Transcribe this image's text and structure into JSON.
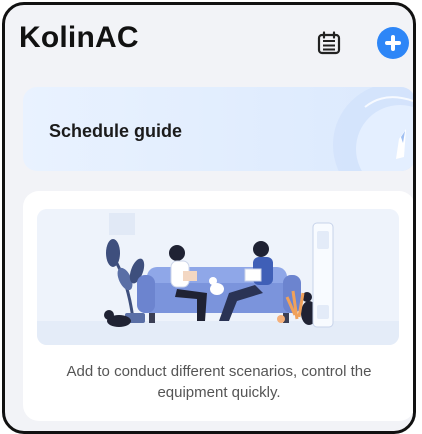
{
  "header": {
    "title": "KolinAC",
    "calendar_icon": "calendar-icon",
    "add_icon": "plus-icon",
    "accent": "#2e86f7"
  },
  "guide": {
    "label": "Schedule guide",
    "icon": "compass-icon"
  },
  "empty_scenes": {
    "illustration": "living-room-illustration",
    "message": "Add to conduct different scenarios, control the equipment quickly."
  }
}
